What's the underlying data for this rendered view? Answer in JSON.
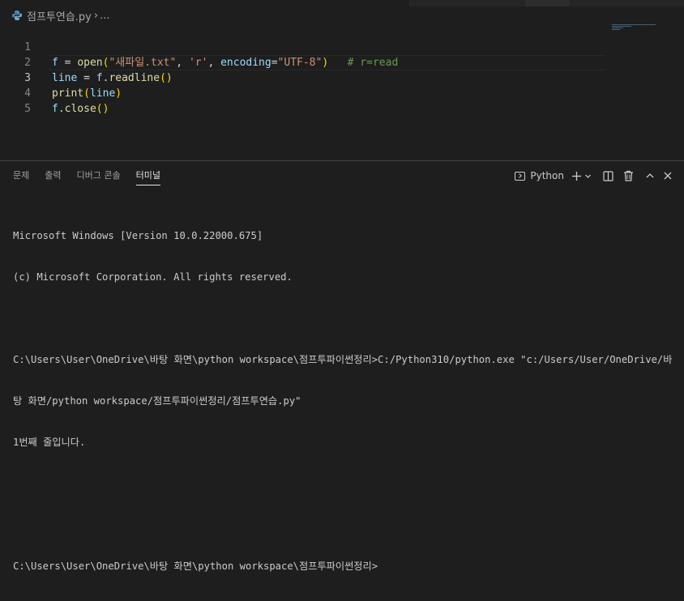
{
  "breadcrumb": {
    "file": "점프투연습.py",
    "separator": "›",
    "more": "..."
  },
  "editor": {
    "lines": [
      {
        "num": "1"
      },
      {
        "num": "2"
      },
      {
        "num": "3"
      },
      {
        "num": "4"
      },
      {
        "num": "5"
      }
    ],
    "active_line": "3",
    "code": {
      "l1_var": "f",
      "l1_eq": " = ",
      "l1_fn": "open",
      "l1_open": "(",
      "l1_arg1": "\"새파일.txt\"",
      "l1_c1": ", ",
      "l1_arg2": "'r'",
      "l1_c2": ", ",
      "l1_kw": "encoding",
      "l1_eq2": "=",
      "l1_arg3": "\"UTF-8\"",
      "l1_close": ")",
      "l1_comment": "   # r=read",
      "l2_var": "line",
      "l2_eq": " = ",
      "l2_obj": "f",
      "l2_dot": ".",
      "l2_fn": "readline",
      "l2_paren": "()",
      "l3_fn": "print",
      "l3_open": "(",
      "l3_arg": "line",
      "l3_close": ")",
      "l4_obj": "f",
      "l4_dot": ".",
      "l4_fn": "close",
      "l4_paren": "()"
    }
  },
  "panel": {
    "tabs": [
      {
        "label": "문제"
      },
      {
        "label": "출력"
      },
      {
        "label": "디버그 콘솔"
      },
      {
        "label": "터미널"
      }
    ],
    "active_tab": "터미널",
    "terminal_name": "Python",
    "icons": [
      "terminal-icon",
      "plus-icon",
      "chevron-down-icon",
      "split-icon",
      "trash-icon",
      "chevron-up-icon",
      "close-icon"
    ]
  },
  "terminal": {
    "lines": [
      "Microsoft Windows [Version 10.0.22000.675]",
      "(c) Microsoft Corporation. All rights reserved.",
      "",
      "C:\\Users\\User\\OneDrive\\바탕 화면\\python workspace\\점프투파이썬정리>C:/Python310/python.exe \"c:/Users/User/OneDrive/바",
      "탕 화면/python workspace/점프투파이썬정리/점프투연습.py\"",
      "1번째 줄입니다.",
      "",
      "",
      "C:\\Users\\User\\OneDrive\\바탕 화면\\python workspace\\점프투파이썬정리>"
    ]
  },
  "colors": {
    "background": "#1e1e1e",
    "variable": "#9cdcfe",
    "function": "#dcdcaa",
    "string": "#ce9178",
    "comment": "#6a9955",
    "bracket": "#ffd700"
  }
}
